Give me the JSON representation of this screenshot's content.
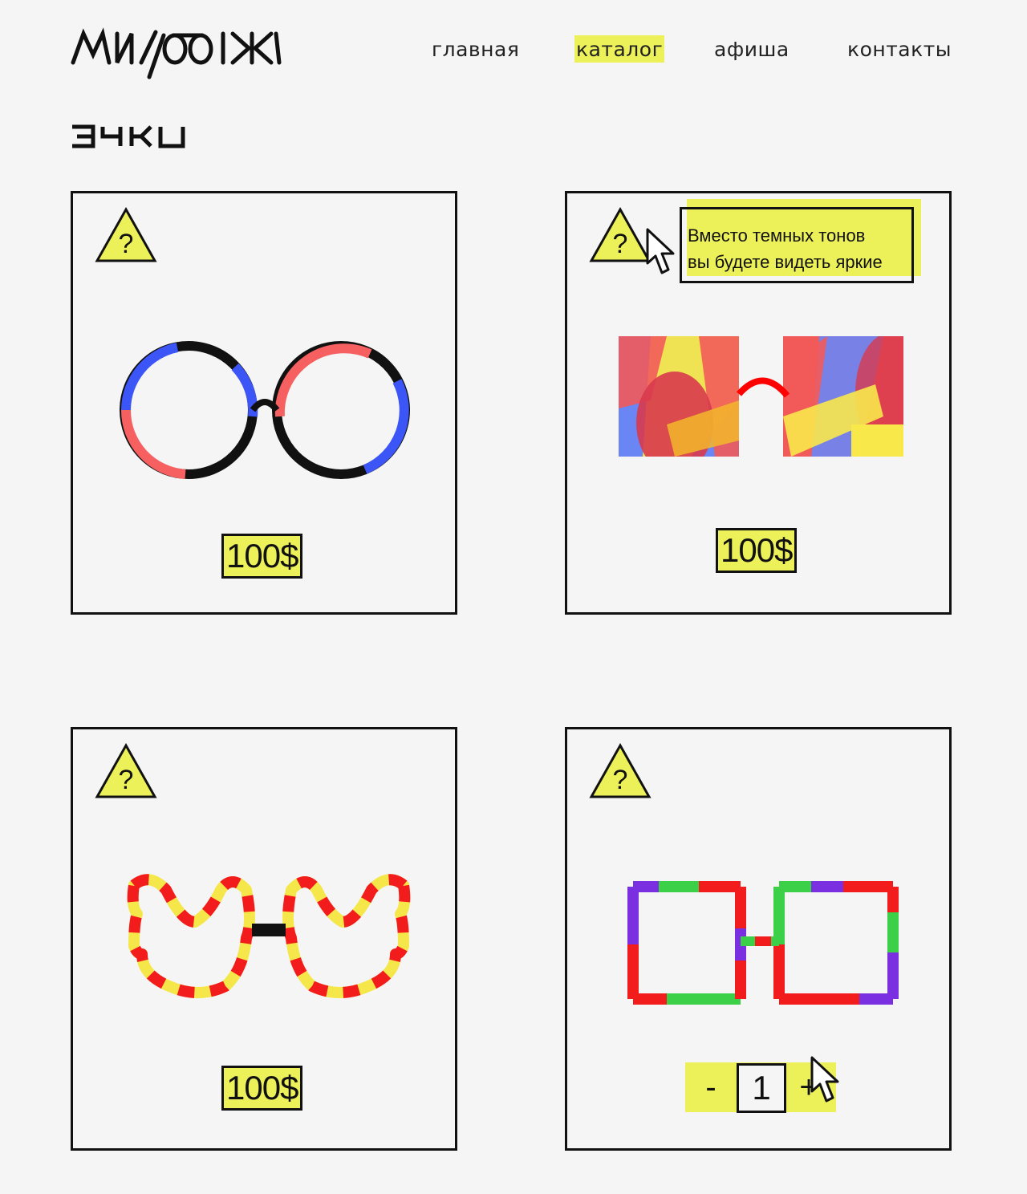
{
  "header": {
    "logo_text": "МИЛОСЖ",
    "nav": [
      {
        "label": "главная",
        "active": false
      },
      {
        "label": "каталог",
        "active": true
      },
      {
        "label": "афиша",
        "active": false
      },
      {
        "label": "контакты",
        "active": false
      }
    ]
  },
  "page": {
    "title": "очки"
  },
  "products": [
    {
      "price": "100$",
      "warning_icon": "question-triangle-icon",
      "image": "round-glasses"
    },
    {
      "price": "100$",
      "warning_icon": "question-triangle-icon",
      "image": "colorful-square-glasses",
      "tooltip": {
        "line1": "Вместо  темных тонов",
        "line2": "вы будете видеть яркие"
      }
    },
    {
      "price": "100$",
      "warning_icon": "question-triangle-icon",
      "image": "wavy-striped-glasses"
    },
    {
      "warning_icon": "question-triangle-icon",
      "image": "square-frame-glasses",
      "stepper": {
        "minus": "-",
        "quantity": "1",
        "plus": "+"
      }
    }
  ],
  "colors": {
    "accent_yellow": "#ecf15a",
    "background": "#f5f5f5",
    "border": "#111111"
  }
}
